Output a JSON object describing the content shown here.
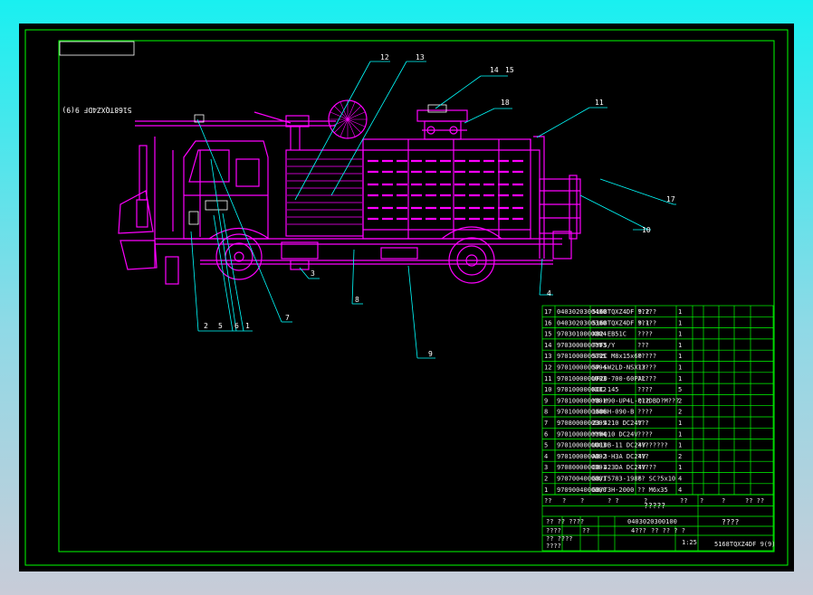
{
  "drawing_code_box": "5168TQXZ4DF 9(9)",
  "callouts": [
    "12",
    "13",
    "14",
    "15",
    "18",
    "11",
    "17",
    "10",
    "4",
    "9",
    "8",
    "3",
    "7",
    "2",
    "5",
    "6",
    "1"
  ],
  "parts_table": {
    "rows": [
      [
        "17",
        "0403020300400",
        "5168TQXZ4DF 9.2",
        "?????",
        "1"
      ],
      [
        "16",
        "0403020300300",
        "5168TQXZ4DF 9.1",
        "?????",
        "1"
      ],
      [
        "15",
        "9703010000004",
        "XB2-EB51C",
        "????",
        "1"
      ],
      [
        "14",
        "9703000000003",
        "TYF5/Y",
        "???",
        "1"
      ],
      [
        "13",
        "9701000000005",
        "ST2C M8x15x60",
        "?????",
        "1"
      ],
      [
        "12",
        "9701000000004",
        "SP-SW2LD-NSX13",
        "?????",
        "1"
      ],
      [
        "11",
        "9701000000003",
        "UF20-700-60PAL",
        "?????",
        "1"
      ],
      [
        "10",
        "9701000000002",
        "KCC-145",
        "????",
        "5"
      ],
      [
        "9",
        "9701000000001",
        "YB-M90-UP4L-Q12",
        "???DBD?M???",
        "2"
      ],
      [
        "8",
        "9701000000006",
        "160BH-090-B",
        "????",
        "2"
      ],
      [
        "7",
        "9708000000005",
        "Z3-4210 DC24V",
        "???",
        "1"
      ],
      [
        "6",
        "9701000000004",
        "YYHQ10 DC24V",
        "????",
        "1"
      ],
      [
        "5",
        "9701000000003",
        "UD10B-11 DC24V",
        "????????",
        "1"
      ],
      [
        "4",
        "9701000000002",
        "AB-3-H3A DC24V",
        "???",
        "2"
      ],
      [
        "3",
        "9708000000001",
        "CB-423DA DC24V",
        "?????",
        "1"
      ],
      [
        "2",
        "9707004000001",
        "GB/T5783-1986",
        "?? SC?5x10",
        "4"
      ],
      [
        "1",
        "9709004000000",
        "GB/T3H-2000",
        "?? M6x35",
        "4"
      ]
    ],
    "footer": [
      "??",
      "?",
      "?",
      "? ?",
      "?",
      "??",
      "?",
      "?",
      "?? ??"
    ]
  },
  "title_block": {
    "company": "?????",
    "drawing_no": "0403020300100",
    "title": "????",
    "model": "5168TQXZ4DF 9(9)",
    "scale": "1:25",
    "remark_1": "4???",
    "remark_2": "?? ?? ? ?",
    "qty": "??",
    "left_labels": [
      "?? ?? ????",
      "????",
      "?? ????",
      "????",
      "????"
    ]
  },
  "colors": {
    "background_top": "#19f0f0",
    "background_bottom": "#c8ccd8",
    "sheet": "#000000",
    "frame": "#00ff00",
    "vehicle": "#ff00ff",
    "leader": "#00ffff",
    "text": "#ffffff"
  },
  "icons": [
    "sweeper-truck-drawing",
    "brush-icon"
  ]
}
